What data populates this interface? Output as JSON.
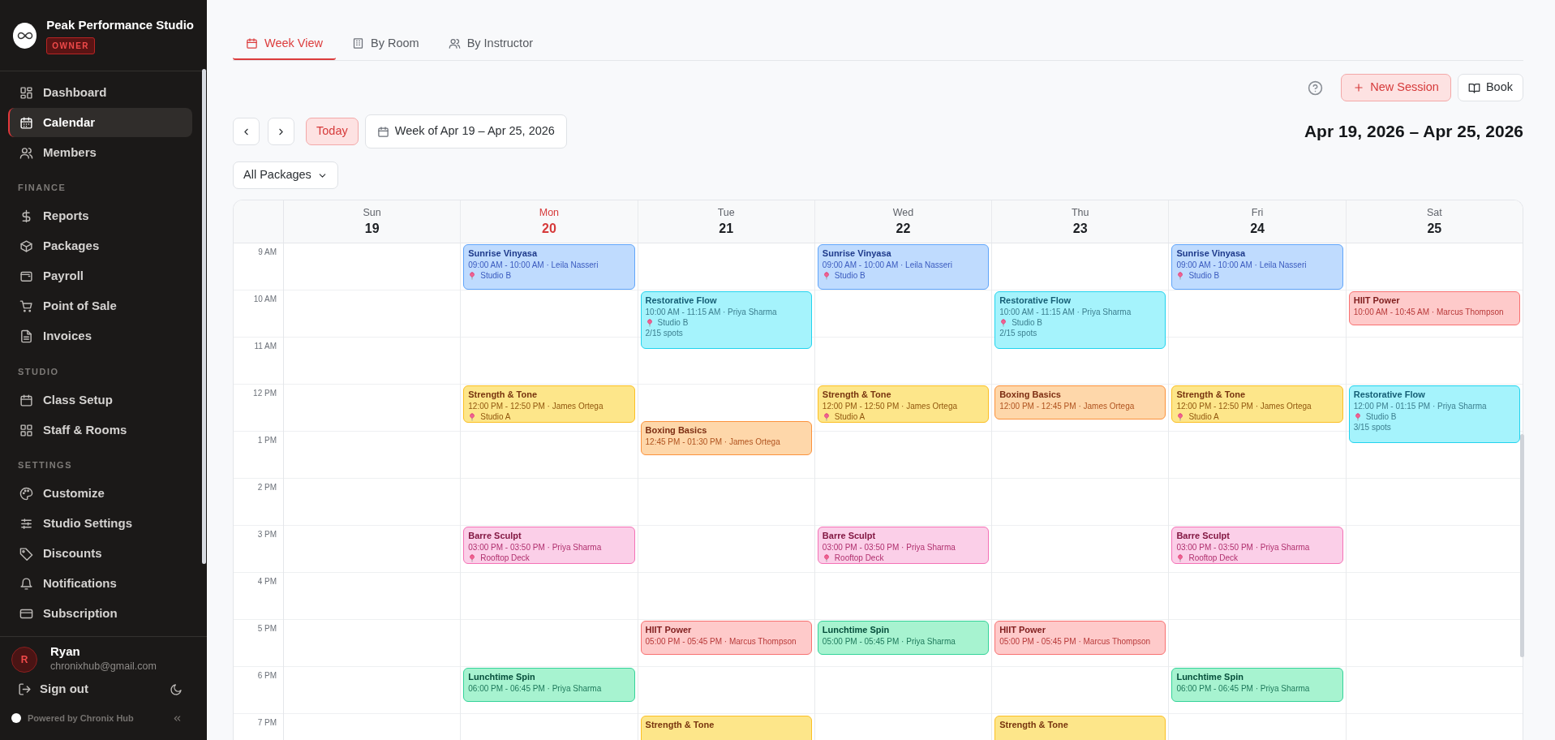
{
  "sidebar": {
    "studio_name": "Peak Performance Studio",
    "role_badge": "OWNER",
    "sections": [
      {
        "items": [
          {
            "label": "Dashboard",
            "selected": false
          },
          {
            "label": "Calendar",
            "selected": true
          },
          {
            "label": "Members",
            "selected": false
          }
        ]
      },
      {
        "heading": "FINANCE",
        "items": [
          {
            "label": "Reports",
            "selected": false
          },
          {
            "label": "Packages",
            "selected": false
          },
          {
            "label": "Payroll",
            "selected": false
          },
          {
            "label": "Point of Sale",
            "selected": false
          },
          {
            "label": "Invoices",
            "selected": false
          }
        ]
      },
      {
        "heading": "STUDIO",
        "items": [
          {
            "label": "Class Setup",
            "selected": false
          },
          {
            "label": "Staff & Rooms",
            "selected": false
          }
        ]
      },
      {
        "heading": "SETTINGS",
        "items": [
          {
            "label": "Customize",
            "selected": false
          },
          {
            "label": "Studio Settings",
            "selected": false
          },
          {
            "label": "Discounts",
            "selected": false
          },
          {
            "label": "Notifications",
            "selected": false
          },
          {
            "label": "Subscription",
            "selected": false
          }
        ]
      }
    ],
    "user": {
      "initial": "R",
      "name": "Ryan",
      "email": "chronixhub@gmail.com"
    },
    "sign_out": "Sign out",
    "footer": "Powered by Chronix Hub"
  },
  "tabs": [
    {
      "label": "Week View",
      "selected": true
    },
    {
      "label": "By Room",
      "selected": false
    },
    {
      "label": "By Instructor",
      "selected": false
    }
  ],
  "toolbar": {
    "new_session": "New Session",
    "book": "Book"
  },
  "navigation": {
    "today": "Today",
    "week_picker": "Week of Apr 19 – Apr 25, 2026",
    "range_title": "Apr 19, 2026 – Apr 25, 2026",
    "filter": "All Packages"
  },
  "calendar": {
    "hours": [
      "9 AM",
      "10 AM",
      "11 AM",
      "12 PM",
      "1 PM",
      "2 PM",
      "3 PM",
      "4 PM",
      "5 PM",
      "6 PM",
      "7 PM"
    ],
    "days": [
      {
        "name": "Sun",
        "date": "19",
        "today": false
      },
      {
        "name": "Mon",
        "date": "20",
        "today": true,
        "events": [
          {
            "title": "Sunrise Vinyasa",
            "time": "09:00 AM - 10:00 AM · Leila Nasseri",
            "room": "Studio B",
            "color": "#bfdbfe"
          },
          {
            "title": "Strength & Tone",
            "time": "12:00 PM - 12:50 PM · James Ortega",
            "room": "Studio A",
            "color": "#fde68a"
          },
          {
            "title": "Barre Sculpt",
            "time": "03:00 PM - 03:50 PM · Priya Sharma",
            "room": "Rooftop Deck",
            "color": "#fbcfe8"
          },
          {
            "title": "Lunchtime Spin",
            "time": "06:00 PM - 06:45 PM · Priya Sharma",
            "color": "#a7f3d0"
          }
        ]
      },
      {
        "name": "Tue",
        "date": "21",
        "today": false,
        "events": [
          {
            "title": "Restorative Flow",
            "time": "10:00 AM - 11:15 AM · Priya Sharma",
            "room": "Studio B",
            "spots": "2/15 spots",
            "color": "#a5f3fc"
          },
          {
            "title": "Boxing Basics",
            "time": "12:45 PM - 01:30 PM · James Ortega",
            "color": "#fed7aa"
          },
          {
            "title": "HIIT Power",
            "time": "05:00 PM - 05:45 PM · Marcus Thompson",
            "color": "#fecaca"
          },
          {
            "title": "Strength & Tone",
            "color": "#fde68a"
          }
        ]
      },
      {
        "name": "Wed",
        "date": "22",
        "today": false,
        "events": [
          {
            "title": "Sunrise Vinyasa",
            "time": "09:00 AM - 10:00 AM · Leila Nasseri",
            "room": "Studio B",
            "color": "#bfdbfe"
          },
          {
            "title": "Strength & Tone",
            "time": "12:00 PM - 12:50 PM · James Ortega",
            "room": "Studio A",
            "color": "#fde68a"
          },
          {
            "title": "Barre Sculpt",
            "time": "03:00 PM - 03:50 PM · Priya Sharma",
            "room": "Rooftop Deck",
            "color": "#fbcfe8"
          },
          {
            "title": "Lunchtime Spin",
            "time": "05:00 PM - 05:45 PM · Priya Sharma",
            "color": "#a7f3d0"
          }
        ]
      },
      {
        "name": "Thu",
        "date": "23",
        "today": false,
        "events": [
          {
            "title": "Restorative Flow",
            "time": "10:00 AM - 11:15 AM · Priya Sharma",
            "room": "Studio B",
            "spots": "2/15 spots",
            "color": "#a5f3fc"
          },
          {
            "title": "Boxing Basics",
            "time": "12:00 PM - 12:45 PM · James Ortega",
            "color": "#fed7aa"
          },
          {
            "title": "HIIT Power",
            "time": "05:00 PM - 05:45 PM · Marcus Thompson",
            "color": "#fecaca"
          },
          {
            "title": "Strength & Tone",
            "color": "#fde68a"
          }
        ]
      },
      {
        "name": "Fri",
        "date": "24",
        "today": false,
        "events": [
          {
            "title": "Sunrise Vinyasa",
            "time": "09:00 AM - 10:00 AM · Leila Nasseri",
            "room": "Studio B",
            "color": "#bfdbfe"
          },
          {
            "title": "Strength & Tone",
            "time": "12:00 PM - 12:50 PM · James Ortega",
            "room": "Studio A",
            "color": "#fde68a"
          },
          {
            "title": "Barre Sculpt",
            "time": "03:00 PM - 03:50 PM · Priya Sharma",
            "room": "Rooftop Deck",
            "color": "#fbcfe8"
          },
          {
            "title": "Lunchtime Spin",
            "time": "06:00 PM - 06:45 PM · Priya Sharma",
            "color": "#a7f3d0"
          }
        ]
      },
      {
        "name": "Sat",
        "date": "25",
        "today": false,
        "events": [
          {
            "title": "HIIT Power",
            "time": "10:00 AM - 10:45 AM · Marcus Thompson",
            "color": "#fecaca"
          },
          {
            "title": "Restorative Flow",
            "time": "12:00 PM - 01:15 PM · Priya Sharma",
            "room": "Studio B",
            "spots": "3/15 spots",
            "color": "#a5f3fc"
          }
        ]
      }
    ]
  }
}
